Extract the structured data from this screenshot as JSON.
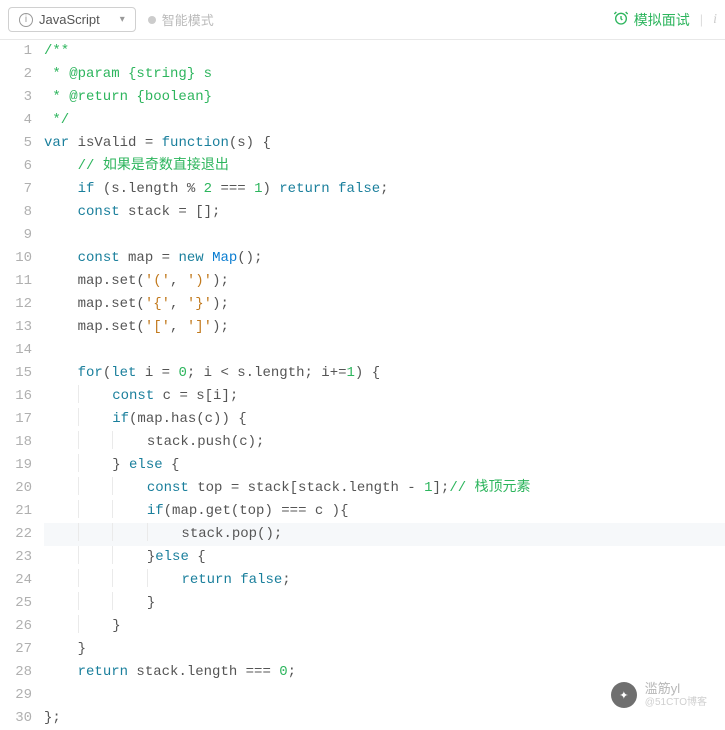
{
  "toolbar": {
    "language": "JavaScript",
    "mode_label": "智能模式",
    "mock_interview": "模拟面试"
  },
  "code": {
    "lines": [
      {
        "n": 1,
        "html": "<span class='tok-comment'>/**</span>"
      },
      {
        "n": 2,
        "html": "<span class='tok-comment'> * @param {string} s</span>"
      },
      {
        "n": 3,
        "html": "<span class='tok-comment'> * @return {boolean}</span>"
      },
      {
        "n": 4,
        "html": "<span class='tok-comment'> */</span>"
      },
      {
        "n": 5,
        "html": "<span class='tok-keyword'>var</span> isValid = <span class='tok-keyword'>function</span>(s) {"
      },
      {
        "n": 6,
        "html": "    <span class='tok-comment'>// 如果是奇数直接退出</span>"
      },
      {
        "n": 7,
        "html": "    <span class='tok-keyword'>if</span> (s.length % <span class='tok-num'>2</span> === <span class='tok-num'>1</span>) <span class='tok-keyword'>return</span> <span class='tok-keyword'>false</span>;"
      },
      {
        "n": 8,
        "html": "    <span class='tok-keyword'>const</span> stack = [];"
      },
      {
        "n": 9,
        "html": ""
      },
      {
        "n": 10,
        "html": "    <span class='tok-keyword'>const</span> map = <span class='tok-keyword'>new</span> <span class='tok-class'>Map</span>();"
      },
      {
        "n": 11,
        "html": "    map.set(<span class='tok-str'>'('</span>, <span class='tok-str'>')'</span>);"
      },
      {
        "n": 12,
        "html": "    map.set(<span class='tok-str'>'{'</span>, <span class='tok-str'>'}'</span>);"
      },
      {
        "n": 13,
        "html": "    map.set(<span class='tok-str'>'['</span>, <span class='tok-str'>']'</span>);"
      },
      {
        "n": 14,
        "html": ""
      },
      {
        "n": 15,
        "html": "    <span class='tok-keyword'>for</span>(<span class='tok-keyword'>let</span> i = <span class='tok-num'>0</span>; i &lt; s.length; i+=<span class='tok-num'>1</span>) {"
      },
      {
        "n": 16,
        "html": "        <span class='tok-keyword'>const</span> c = s[i];"
      },
      {
        "n": 17,
        "html": "        <span class='tok-keyword'>if</span>(map.has(c)) {"
      },
      {
        "n": 18,
        "html": "            stack.push(c);"
      },
      {
        "n": 19,
        "html": "        } <span class='tok-keyword'>else</span> {"
      },
      {
        "n": 20,
        "html": "            <span class='tok-keyword'>const</span> top = stack[stack.length - <span class='tok-num'>1</span>];<span class='tok-comment'>// 栈顶元素</span>"
      },
      {
        "n": 21,
        "html": "            <span class='tok-keyword'>if</span>(map.get(top) === c ){"
      },
      {
        "n": 22,
        "html": "                stack.pop();",
        "active": true
      },
      {
        "n": 23,
        "html": "            }<span class='tok-keyword'>else</span> {"
      },
      {
        "n": 24,
        "html": "                <span class='tok-keyword'>return</span> <span class='tok-keyword'>false</span>;"
      },
      {
        "n": 25,
        "html": "            }"
      },
      {
        "n": 26,
        "html": "        }"
      },
      {
        "n": 27,
        "html": "    }"
      },
      {
        "n": 28,
        "html": "    <span class='tok-keyword'>return</span> stack.length === <span class='tok-num'>0</span>;"
      },
      {
        "n": 29,
        "html": ""
      },
      {
        "n": 30,
        "html": "};"
      }
    ]
  },
  "watermark": {
    "main": "滥筋yl",
    "sub": "@51CTO博客"
  }
}
